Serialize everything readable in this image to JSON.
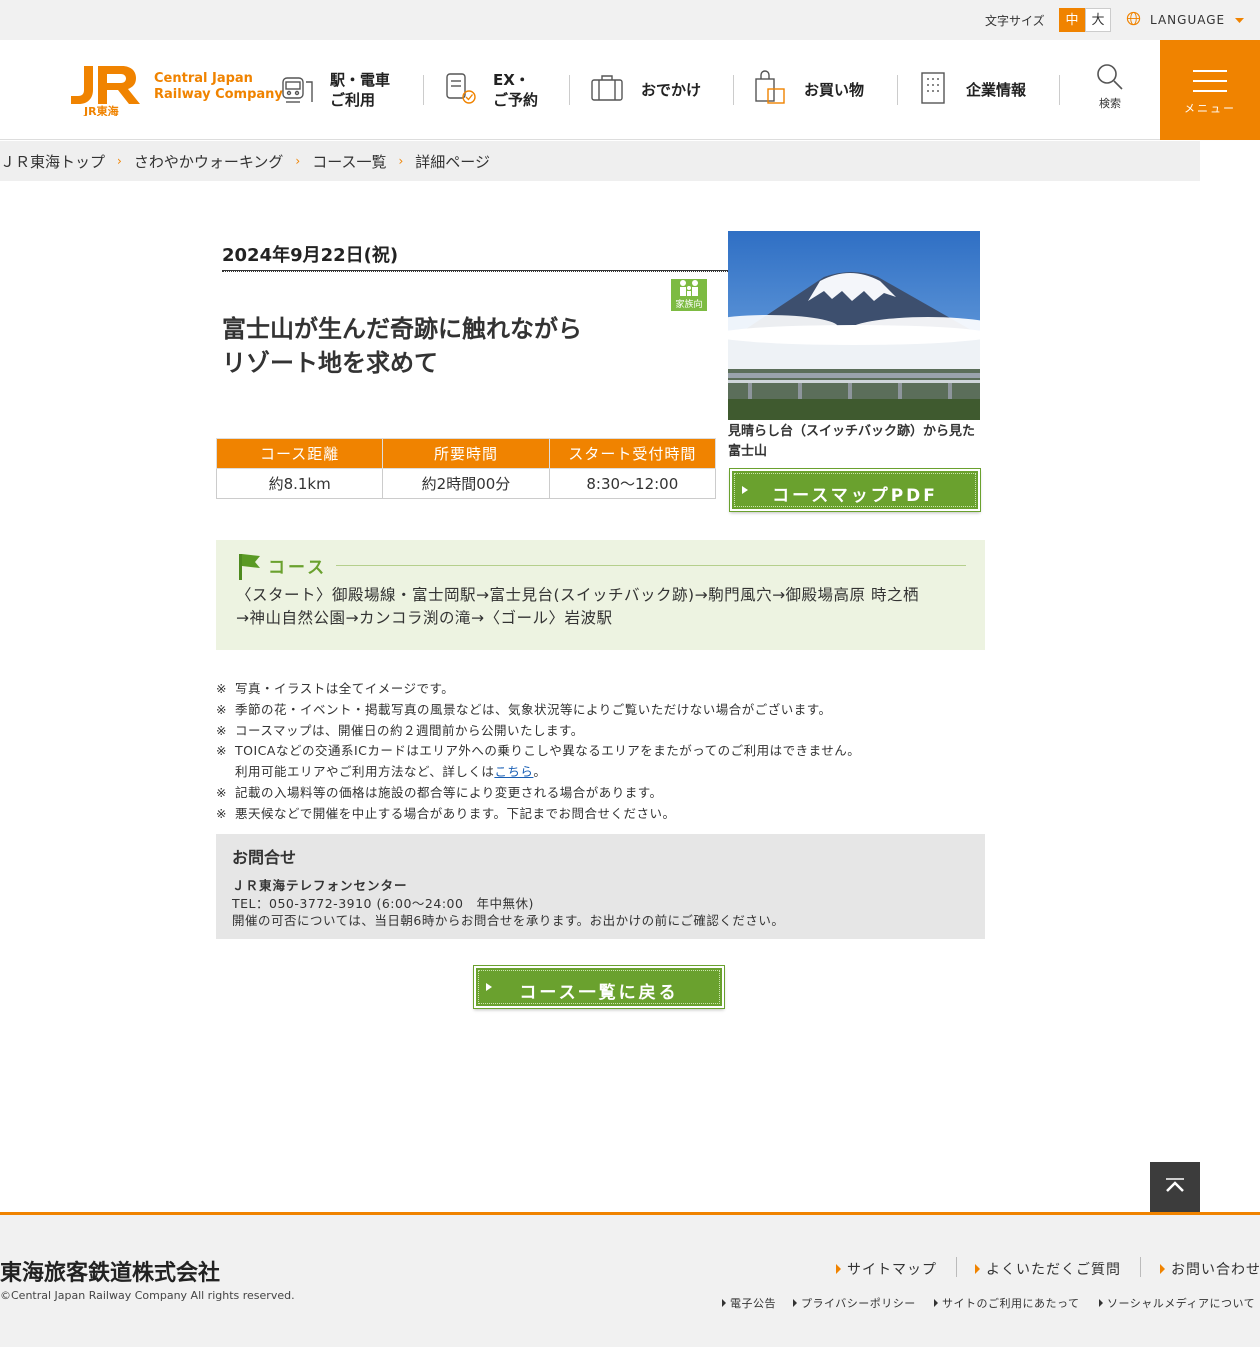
{
  "utility": {
    "font_size_label": "文字サイズ",
    "font_size_mid": "中",
    "font_size_large": "大",
    "language_label": "LANGUAGE"
  },
  "header": {
    "logo_mark": "JR東海",
    "logo_text_line1": "Central Japan",
    "logo_text_line2": "Railway Company",
    "nav": [
      {
        "line1": "駅・電車",
        "line2": "ご利用"
      },
      {
        "line1": "EX・",
        "line2": "ご予約"
      },
      {
        "line1": "おでかけ",
        "line2": ""
      },
      {
        "line1": "お買い物",
        "line2": ""
      },
      {
        "line1": "企業情報",
        "line2": ""
      }
    ],
    "search_label": "検索",
    "menu_label": "メニュー"
  },
  "breadcrumb": [
    "ＪＲ東海トップ",
    "さわやかウォーキング",
    "コース一覧",
    "詳細ページ"
  ],
  "event": {
    "date": "2024年9月22日(祝)",
    "badge_label": "家族向",
    "title_line1": "富士山が生んだ奇跡に触れながら",
    "title_line2": "リゾート地を求めて",
    "photo_caption": "見晴らし台（スイッチバック跡）から見た富士山",
    "pdf_button": "コースマップPDF"
  },
  "info_table": {
    "headers": [
      "コース距離",
      "所要時間",
      "スタート受付時間"
    ],
    "values": [
      "約8.1km",
      "約2時間00分",
      "8:30〜12:00"
    ]
  },
  "course": {
    "heading": "コース",
    "route_line1": "〈スタート〉御殿場線・富士岡駅→富士見台(スイッチバック跡)→駒門風穴→御殿場高原 時之栖",
    "route_line2": "→神山自然公園→カンコラ渕の滝→〈ゴール〉岩波駅"
  },
  "notes": {
    "mark": "※",
    "n1": "写真・イラストは全てイメージです。",
    "n2": "季節の花・イベント・掲載写真の風景などは、気象状況等によりご覧いただけない場合がございます。",
    "n3": "コースマップは、開催日の約２週間前から公開いたします。",
    "n4": "TOICAなどの交通系ICカードはエリア外への乗りこしや異なるエリアをまたがってのご利用はできません。",
    "n4b_pre": "利用可能エリアやご利用方法など、詳しくは",
    "n4b_link": "こちら",
    "n4b_post": "。",
    "n5": "記載の入場料等の価格は施設の都合等により変更される場合があります。",
    "n6": "悪天候などで開催を中止する場合があります。下記までお問合せください。"
  },
  "contact": {
    "title": "お問合せ",
    "org": "ＪＲ東海テレフォンセンター",
    "tel": "TEL：050-3772-3910 (6:00〜24:00　年中無休)",
    "note": "開催の可否については、当日朝6時からお問合せを承ります。お出かけの前にご確認ください。"
  },
  "back_button": "コース一覧に戻る",
  "footer": {
    "company": "東海旅客鉄道株式会社",
    "copyright": "©Central Japan Railway Company All rights reserved.",
    "links": [
      "サイトマップ",
      "よくいただくご質問",
      "お問い合わせ"
    ],
    "sub_links": [
      "電子公告",
      "プライバシーポリシー",
      "サイトのご利用にあたって",
      "ソーシャルメディアについて"
    ]
  },
  "colors": {
    "brand_orange": "#f08300",
    "button_green": "#6aa12e",
    "course_bg": "#edf3e1"
  }
}
